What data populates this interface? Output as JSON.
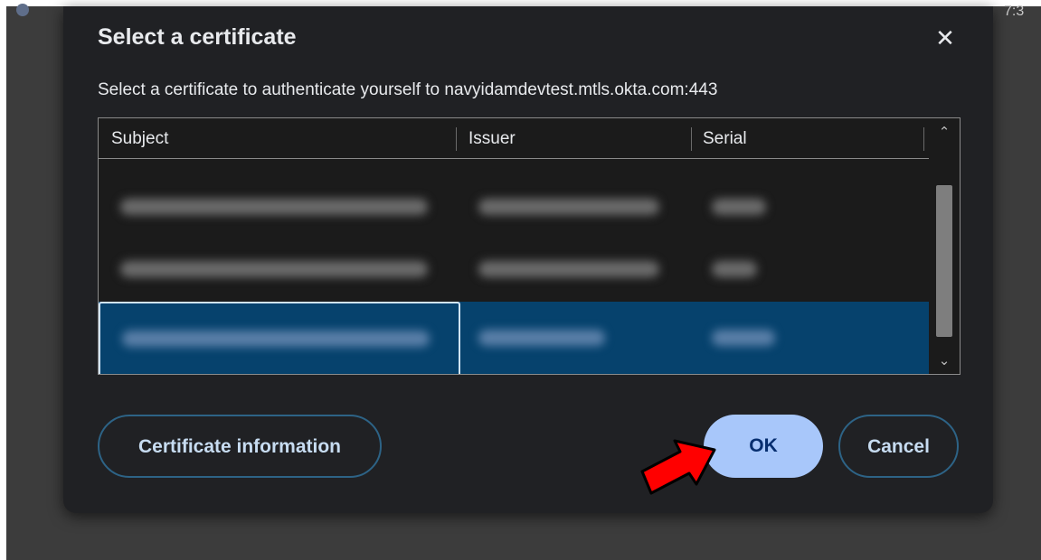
{
  "background": {
    "right_corner_text": "7:3"
  },
  "dialog": {
    "title": "Select a certificate",
    "close_icon": "close-icon",
    "subtitle": "Select a certificate to authenticate yourself to navyidamdevtest.mtls.okta.com:443",
    "table": {
      "columns": [
        "Subject",
        "Issuer",
        "Serial"
      ],
      "rows": [
        {
          "subject": "",
          "issuer": "",
          "serial": "",
          "selected": false,
          "redacted": true
        },
        {
          "subject": "",
          "issuer": "",
          "serial": "",
          "selected": false,
          "redacted": true
        },
        {
          "subject": "",
          "issuer": "",
          "serial": "",
          "selected": true,
          "redacted": true
        }
      ]
    },
    "buttons": {
      "certificate_information": "Certificate information",
      "ok": "OK",
      "cancel": "Cancel"
    }
  },
  "annotation": {
    "icon": "red-arrow-icon",
    "color": "#ff0000"
  }
}
